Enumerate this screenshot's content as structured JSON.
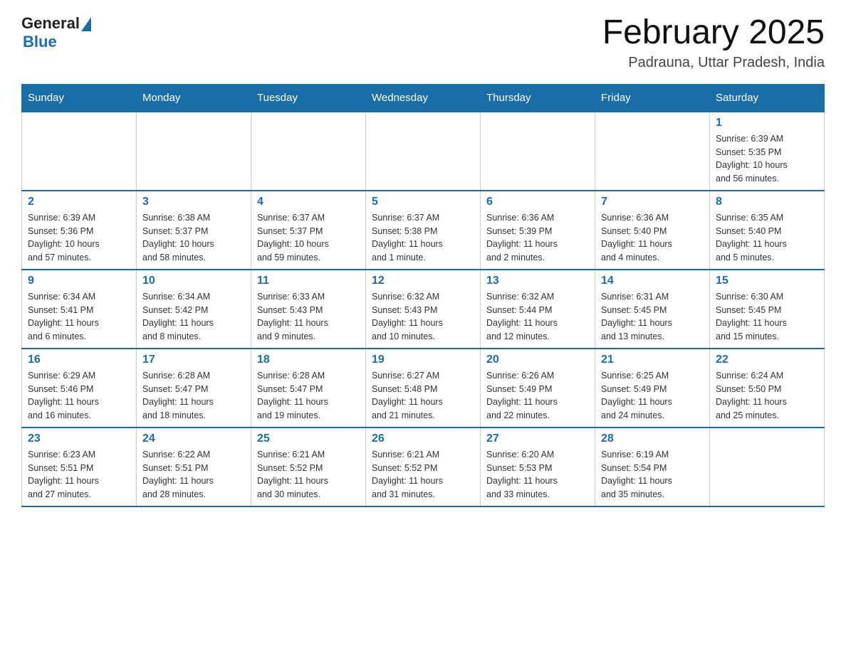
{
  "logo": {
    "general": "General",
    "blue": "Blue"
  },
  "title": "February 2025",
  "location": "Padrauna, Uttar Pradesh, India",
  "weekdays": [
    "Sunday",
    "Monday",
    "Tuesday",
    "Wednesday",
    "Thursday",
    "Friday",
    "Saturday"
  ],
  "weeks": [
    [
      {
        "day": "",
        "info": ""
      },
      {
        "day": "",
        "info": ""
      },
      {
        "day": "",
        "info": ""
      },
      {
        "day": "",
        "info": ""
      },
      {
        "day": "",
        "info": ""
      },
      {
        "day": "",
        "info": ""
      },
      {
        "day": "1",
        "info": "Sunrise: 6:39 AM\nSunset: 5:35 PM\nDaylight: 10 hours\nand 56 minutes."
      }
    ],
    [
      {
        "day": "2",
        "info": "Sunrise: 6:39 AM\nSunset: 5:36 PM\nDaylight: 10 hours\nand 57 minutes."
      },
      {
        "day": "3",
        "info": "Sunrise: 6:38 AM\nSunset: 5:37 PM\nDaylight: 10 hours\nand 58 minutes."
      },
      {
        "day": "4",
        "info": "Sunrise: 6:37 AM\nSunset: 5:37 PM\nDaylight: 10 hours\nand 59 minutes."
      },
      {
        "day": "5",
        "info": "Sunrise: 6:37 AM\nSunset: 5:38 PM\nDaylight: 11 hours\nand 1 minute."
      },
      {
        "day": "6",
        "info": "Sunrise: 6:36 AM\nSunset: 5:39 PM\nDaylight: 11 hours\nand 2 minutes."
      },
      {
        "day": "7",
        "info": "Sunrise: 6:36 AM\nSunset: 5:40 PM\nDaylight: 11 hours\nand 4 minutes."
      },
      {
        "day": "8",
        "info": "Sunrise: 6:35 AM\nSunset: 5:40 PM\nDaylight: 11 hours\nand 5 minutes."
      }
    ],
    [
      {
        "day": "9",
        "info": "Sunrise: 6:34 AM\nSunset: 5:41 PM\nDaylight: 11 hours\nand 6 minutes."
      },
      {
        "day": "10",
        "info": "Sunrise: 6:34 AM\nSunset: 5:42 PM\nDaylight: 11 hours\nand 8 minutes."
      },
      {
        "day": "11",
        "info": "Sunrise: 6:33 AM\nSunset: 5:43 PM\nDaylight: 11 hours\nand 9 minutes."
      },
      {
        "day": "12",
        "info": "Sunrise: 6:32 AM\nSunset: 5:43 PM\nDaylight: 11 hours\nand 10 minutes."
      },
      {
        "day": "13",
        "info": "Sunrise: 6:32 AM\nSunset: 5:44 PM\nDaylight: 11 hours\nand 12 minutes."
      },
      {
        "day": "14",
        "info": "Sunrise: 6:31 AM\nSunset: 5:45 PM\nDaylight: 11 hours\nand 13 minutes."
      },
      {
        "day": "15",
        "info": "Sunrise: 6:30 AM\nSunset: 5:45 PM\nDaylight: 11 hours\nand 15 minutes."
      }
    ],
    [
      {
        "day": "16",
        "info": "Sunrise: 6:29 AM\nSunset: 5:46 PM\nDaylight: 11 hours\nand 16 minutes."
      },
      {
        "day": "17",
        "info": "Sunrise: 6:28 AM\nSunset: 5:47 PM\nDaylight: 11 hours\nand 18 minutes."
      },
      {
        "day": "18",
        "info": "Sunrise: 6:28 AM\nSunset: 5:47 PM\nDaylight: 11 hours\nand 19 minutes."
      },
      {
        "day": "19",
        "info": "Sunrise: 6:27 AM\nSunset: 5:48 PM\nDaylight: 11 hours\nand 21 minutes."
      },
      {
        "day": "20",
        "info": "Sunrise: 6:26 AM\nSunset: 5:49 PM\nDaylight: 11 hours\nand 22 minutes."
      },
      {
        "day": "21",
        "info": "Sunrise: 6:25 AM\nSunset: 5:49 PM\nDaylight: 11 hours\nand 24 minutes."
      },
      {
        "day": "22",
        "info": "Sunrise: 6:24 AM\nSunset: 5:50 PM\nDaylight: 11 hours\nand 25 minutes."
      }
    ],
    [
      {
        "day": "23",
        "info": "Sunrise: 6:23 AM\nSunset: 5:51 PM\nDaylight: 11 hours\nand 27 minutes."
      },
      {
        "day": "24",
        "info": "Sunrise: 6:22 AM\nSunset: 5:51 PM\nDaylight: 11 hours\nand 28 minutes."
      },
      {
        "day": "25",
        "info": "Sunrise: 6:21 AM\nSunset: 5:52 PM\nDaylight: 11 hours\nand 30 minutes."
      },
      {
        "day": "26",
        "info": "Sunrise: 6:21 AM\nSunset: 5:52 PM\nDaylight: 11 hours\nand 31 minutes."
      },
      {
        "day": "27",
        "info": "Sunrise: 6:20 AM\nSunset: 5:53 PM\nDaylight: 11 hours\nand 33 minutes."
      },
      {
        "day": "28",
        "info": "Sunrise: 6:19 AM\nSunset: 5:54 PM\nDaylight: 11 hours\nand 35 minutes."
      },
      {
        "day": "",
        "info": ""
      }
    ]
  ]
}
